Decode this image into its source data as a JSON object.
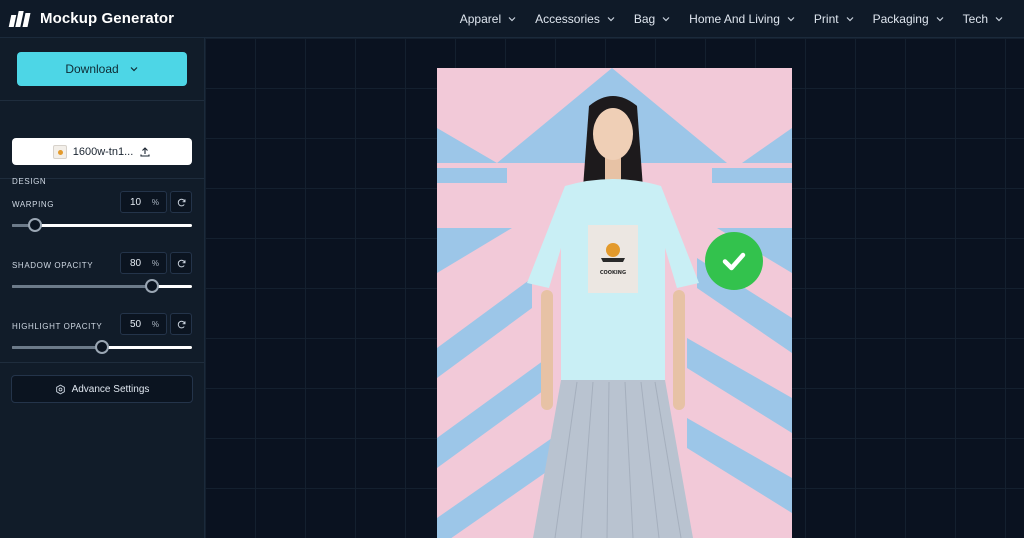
{
  "app": {
    "title": "Mockup Generator"
  },
  "nav": {
    "items": [
      {
        "label": "Apparel"
      },
      {
        "label": "Accessories"
      },
      {
        "label": "Bag"
      },
      {
        "label": "Home And Living"
      },
      {
        "label": "Print"
      },
      {
        "label": "Packaging"
      },
      {
        "label": "Tech"
      }
    ]
  },
  "sidebar": {
    "download_label": "Download",
    "design": {
      "section_label": "DESIGN",
      "file_name": "1600w-tn1..."
    },
    "warping": {
      "label": "WARPING",
      "value": "10",
      "unit": "%",
      "level": 0.13
    },
    "shadow_opacity": {
      "label": "SHADOW OPACITY",
      "value": "80",
      "unit": "%",
      "level": 0.78
    },
    "highlight_opacity": {
      "label": "HIGHLIGHT OPACITY",
      "value": "50",
      "unit": "%",
      "level": 0.5
    },
    "advance_settings_label": "Advance Settings"
  },
  "mockup": {
    "print_text": "COOKING",
    "colors": {
      "background": "#f2c9d8",
      "stripes": "#9cc6e8",
      "tshirt": "#c9eff5",
      "skirt": "#b9c3d0",
      "check": "#33c24d"
    }
  },
  "colors": {
    "accent": "#4dd6e6",
    "topbar": "#0f1a28",
    "sidebar": "#111c29",
    "canvas": "#0a1220"
  }
}
